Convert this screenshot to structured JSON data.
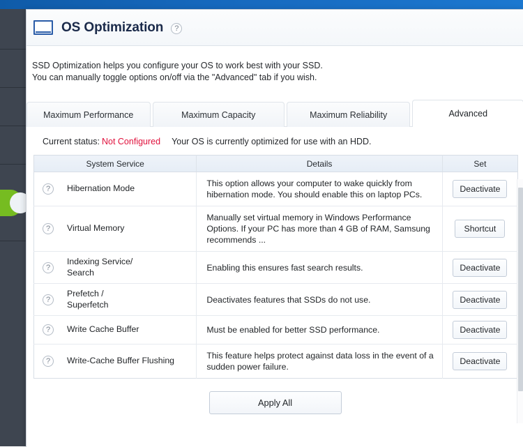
{
  "window": {
    "title": "OS Optimization",
    "title_help_icon": "question-mark-icon",
    "description_line1": "SSD Optimization helps you configure your OS to work best with your SSD.",
    "description_line2": "You can manually toggle options on/off via the \"Advanced\" tab if you wish."
  },
  "tabs": [
    {
      "label": "Maximum Performance",
      "active": false
    },
    {
      "label": "Maximum Capacity",
      "active": false
    },
    {
      "label": "Maximum Reliability",
      "active": false
    },
    {
      "label": "Advanced",
      "active": true
    }
  ],
  "status": {
    "label": "Current status:",
    "value": "Not Configured",
    "value_color": "#e0113c",
    "note": "Your OS is currently optimized for use with an HDD."
  },
  "table": {
    "headers": {
      "service": "System Service",
      "details": "Details",
      "set": "Set"
    },
    "rows": [
      {
        "help_icon": "question-mark-icon",
        "service": "Hibernation Mode",
        "details": "This option allows your computer to wake quickly from hibernation mode. You should enable this on laptop PCs.",
        "button": "Deactivate"
      },
      {
        "help_icon": "question-mark-icon",
        "service": "Virtual Memory",
        "details": "Manually set virtual memory in Windows Performance Options. If your PC has more than 4 GB of RAM, Samsung recommends ...",
        "button": "Shortcut"
      },
      {
        "help_icon": "question-mark-icon",
        "service": "Indexing Service/\nSearch",
        "details": "Enabling this ensures fast search results.",
        "button": "Deactivate"
      },
      {
        "help_icon": "question-mark-icon",
        "service": "Prefetch /\nSuperfetch",
        "details": "Deactivates features that SSDs do not use.",
        "button": "Deactivate"
      },
      {
        "help_icon": "question-mark-icon",
        "service": "Write Cache Buffer",
        "details": "Must be enabled for better SSD performance.",
        "button": "Deactivate"
      },
      {
        "help_icon": "question-mark-icon",
        "service": "Write-Cache Buffer Flushing",
        "details": "This feature helps protect against data loss in the event of a sudden power failure.",
        "button": "Deactivate"
      }
    ]
  },
  "footer": {
    "apply_all": "Apply All"
  },
  "theme": {
    "topbar_blue": "#1668bd",
    "sidebar_dark": "#3e4550",
    "accent_green": "#76bc21",
    "title_navy": "#1b2a4a"
  }
}
